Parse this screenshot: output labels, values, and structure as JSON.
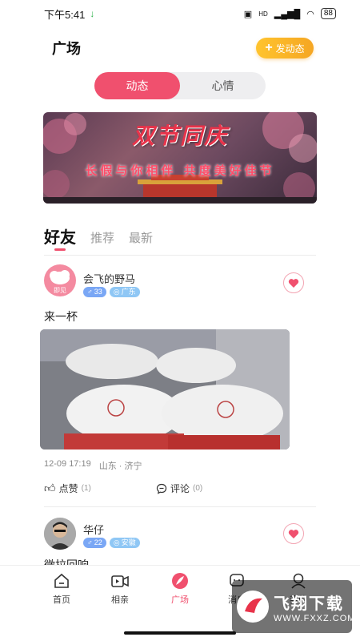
{
  "status_bar": {
    "time": "下午5:41",
    "battery": "88",
    "net_label": "HD"
  },
  "header": {
    "title": "广场",
    "post_button": "发动态"
  },
  "segmented": {
    "tabs": [
      "动态",
      "心情"
    ],
    "active_index": 0
  },
  "banner": {
    "title": "双节同庆",
    "subtitle": "长假与你相伴 共度美好佳节"
  },
  "feed_tabs": {
    "items": [
      "好友",
      "推荐",
      "最新"
    ],
    "active_index": 0
  },
  "posts": [
    {
      "username": "会飞的野马",
      "avatar_caption": "即见",
      "age": "33",
      "location": "广东",
      "text": "来一杯",
      "timestamp": "12-09 17:19",
      "place": "山东 · 济宁",
      "like_label": "点赞",
      "like_count": "(1)",
      "comment_label": "评论",
      "comment_count": "(0)",
      "liked": true
    },
    {
      "username": "华仔",
      "age": "22",
      "location": "安徽",
      "text": "微拉回响",
      "liked": true
    }
  ],
  "bottom_nav": {
    "items": [
      "首页",
      "相亲",
      "广场",
      "消息",
      "我的"
    ],
    "active_index": 2
  },
  "watermark": {
    "title": "飞翔下载",
    "url": "WWW.FXXZ.COM"
  },
  "colors": {
    "accent": "#f0506e",
    "post_button": "#f5a623",
    "tag_gender": "#7aa7f5",
    "tag_location": "#8fc7f5"
  }
}
